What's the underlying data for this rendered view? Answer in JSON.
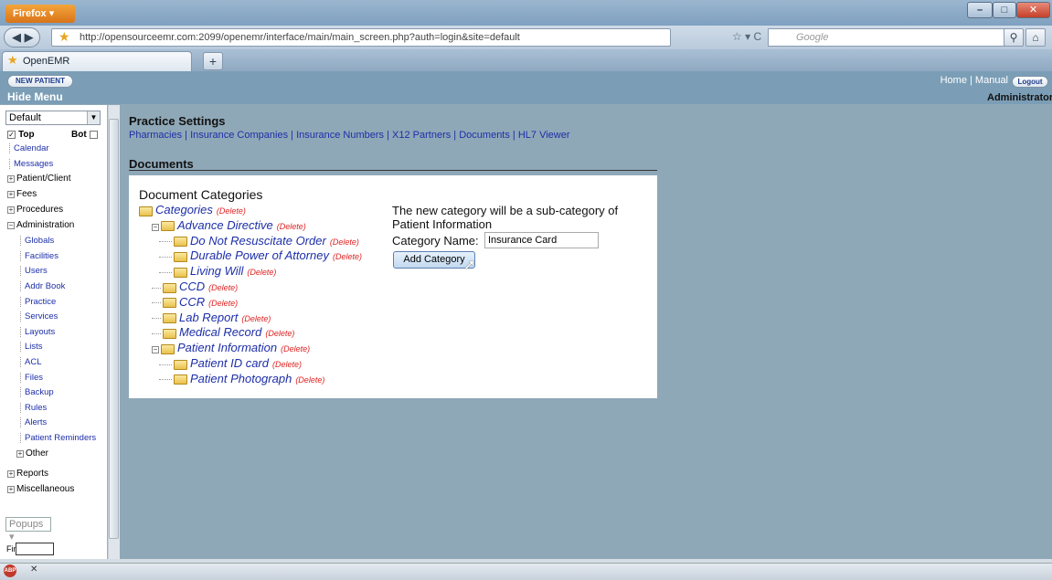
{
  "browser": {
    "menu_button": "Firefox",
    "url": "http://opensourceemr.com:2099/openemr/interface/main/main_screen.php?auth=login&site=default",
    "search_placeholder": "Google",
    "tab_title": "OpenEMR",
    "new_tab": "+"
  },
  "app": {
    "new_patient": "NEW PATIENT",
    "hide_menu": "Hide Menu",
    "home": "Home",
    "manual": "Manual",
    "logout": "Logout",
    "user": "Administrator",
    "link_sep": "|"
  },
  "left_nav": {
    "select": "Default",
    "top_label": "Top",
    "bot_label": "Bot",
    "top_items": [
      "Calendar",
      "Messages"
    ],
    "groups": [
      {
        "label": "Patient/Client"
      },
      {
        "label": "Fees"
      },
      {
        "label": "Procedures"
      }
    ],
    "admin_label": "Administration",
    "admin_items": [
      "Globals",
      "Facilities",
      "Users",
      "Addr Book",
      "Practice",
      "Services",
      "Layouts",
      "Lists",
      "ACL",
      "Files",
      "Backup",
      "Rules",
      "Alerts",
      "Patient Reminders"
    ],
    "other_label": "Other",
    "reports_label": "Reports",
    "misc_label": "Miscellaneous",
    "popups": "Popups",
    "find_label": "Find:"
  },
  "main": {
    "practice_title": "Practice Settings",
    "practice_links": [
      "Pharmacies",
      "Insurance Companies",
      "Insurance Numbers",
      "X12 Partners",
      "Documents",
      "HL7 Viewer"
    ],
    "documents_title": "Documents",
    "doc_categories_title": "Document Categories",
    "delete_label": "(Delete)",
    "tree": [
      {
        "label": "Categories",
        "level": 0
      },
      {
        "label": "Advance Directive",
        "level": 1
      },
      {
        "label": "Do Not Resuscitate Order",
        "level": 2
      },
      {
        "label": "Durable Power of Attorney",
        "level": 2
      },
      {
        "label": "Living Will",
        "level": 2
      },
      {
        "label": "CCD",
        "level": 1
      },
      {
        "label": "CCR",
        "level": 1
      },
      {
        "label": "Lab Report",
        "level": 1
      },
      {
        "label": "Medical Record",
        "level": 1
      },
      {
        "label": "Patient Information",
        "level": 1
      },
      {
        "label": "Patient ID card",
        "level": 2
      },
      {
        "label": "Patient Photograph",
        "level": 2
      }
    ],
    "new_category_text": "The new category will be a sub-category of Patient Information",
    "category_name_label": "Category Name:",
    "category_name_value": "Insurance Card",
    "add_category_button": "Add Category"
  },
  "colors": {
    "app_background": "#8fa8b8",
    "link": "#1d2fa8",
    "delete": "#dd2222"
  }
}
